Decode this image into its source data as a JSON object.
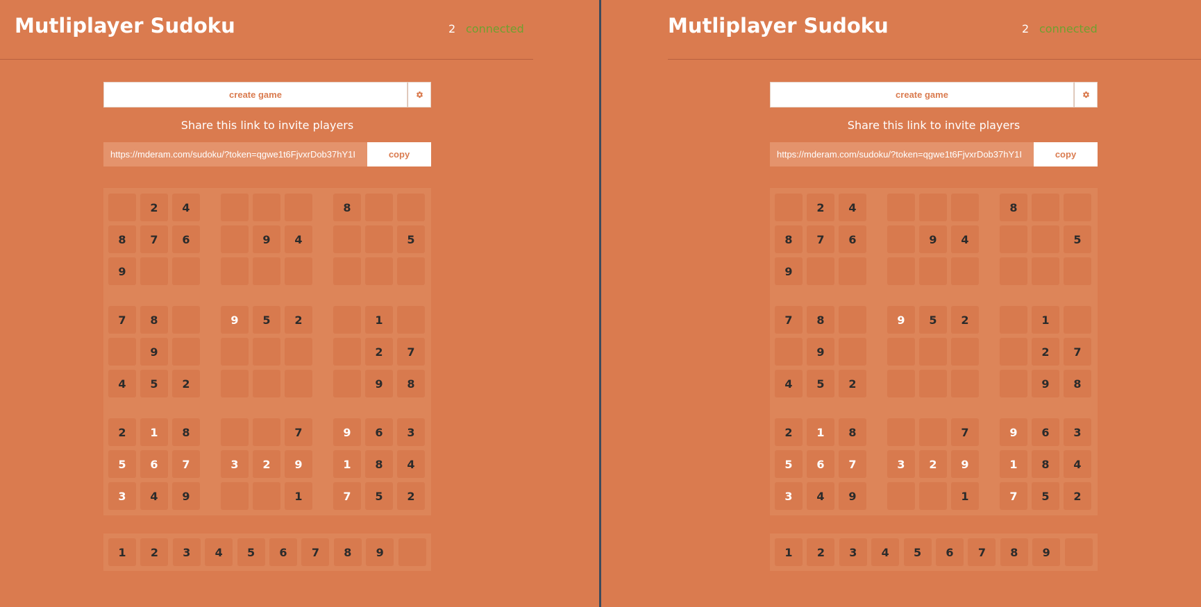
{
  "app": {
    "title": "Mutliplayer Sudoku",
    "connected_count": "2",
    "connection_status": "connected",
    "create_game_label": "create game",
    "settings_icon": "gear-icon",
    "share_text": "Share this link to invite players",
    "share_link": "https://mderam.com/sudoku/?token=qgwe1t6FjvxrDob37hY1I",
    "copy_label": "copy"
  },
  "colors": {
    "background": "#da7b4f",
    "status_connected": "#6fa030",
    "given_digit": "#2b2b2b",
    "player_digit": "#ffffff"
  },
  "board": [
    [
      "",
      "2",
      "4",
      "",
      "",
      "",
      "8",
      "",
      ""
    ],
    [
      "8",
      "7",
      "6",
      "",
      "9",
      "4",
      "",
      "",
      "5"
    ],
    [
      "9",
      "",
      "",
      "",
      "",
      "",
      "",
      "",
      ""
    ],
    [
      "7",
      "8",
      "",
      "9",
      "5",
      "2",
      "",
      "1",
      ""
    ],
    [
      "",
      "9",
      "",
      "",
      "",
      "",
      "",
      "2",
      "7"
    ],
    [
      "4",
      "5",
      "2",
      "",
      "",
      "",
      "",
      "9",
      "8"
    ],
    [
      "2",
      "1",
      "8",
      "",
      "",
      "7",
      "9",
      "6",
      "3"
    ],
    [
      "5",
      "6",
      "7",
      "3",
      "2",
      "9",
      "1",
      "8",
      "4"
    ],
    [
      "3",
      "4",
      "9",
      "",
      "",
      "1",
      "7",
      "5",
      "2"
    ]
  ],
  "player_cells": [
    [
      3,
      3
    ],
    [
      6,
      6
    ],
    [
      7,
      0
    ],
    [
      7,
      1
    ],
    [
      7,
      2
    ],
    [
      7,
      3
    ],
    [
      7,
      4
    ],
    [
      7,
      5
    ],
    [
      7,
      6
    ],
    [
      8,
      0
    ],
    [
      8,
      6
    ],
    [
      6,
      1
    ]
  ],
  "numpad": [
    "1",
    "2",
    "3",
    "4",
    "5",
    "6",
    "7",
    "8",
    "9",
    ""
  ]
}
